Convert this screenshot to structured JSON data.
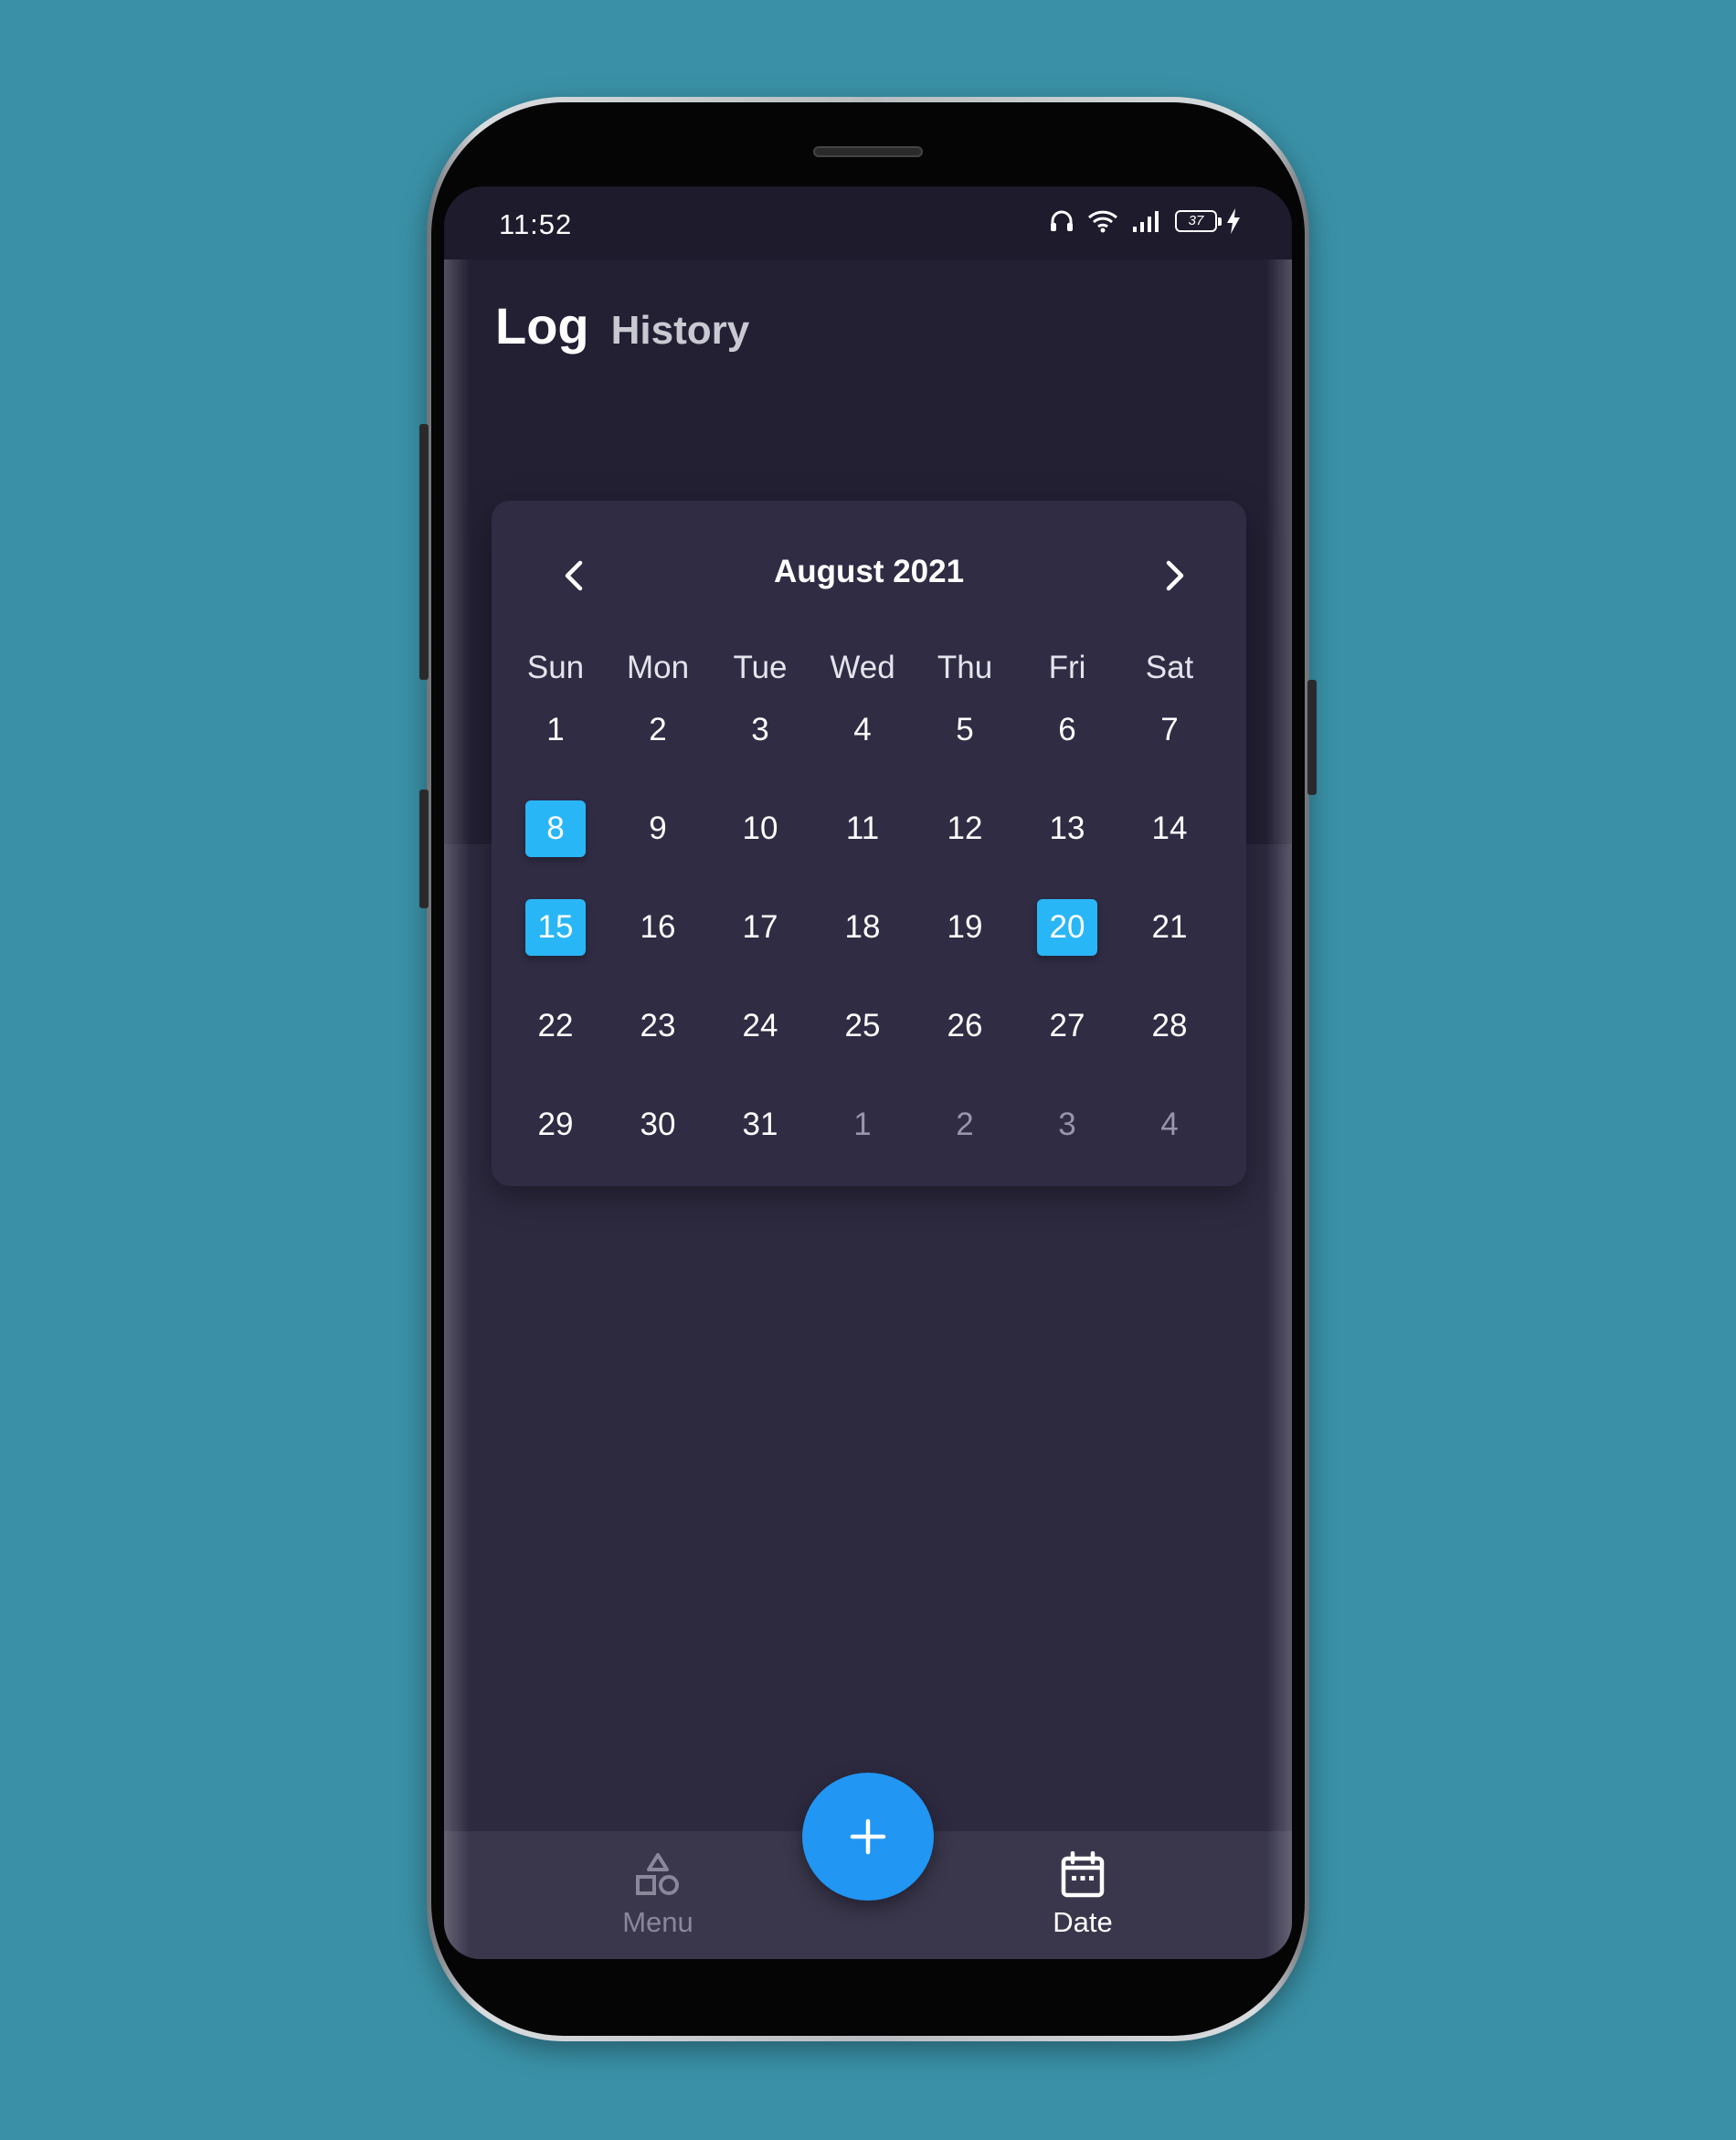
{
  "status_bar": {
    "time": "11:52",
    "battery_level": "37",
    "icons": [
      "headphones-icon",
      "wifi-icon",
      "signal-icon",
      "battery-icon",
      "charging-icon"
    ]
  },
  "header": {
    "title": "Log",
    "subtitle": "History"
  },
  "calendar": {
    "month_label": "August 2021",
    "weekdays": [
      "Sun",
      "Mon",
      "Tue",
      "Wed",
      "Thu",
      "Fri",
      "Sat"
    ],
    "weeks": [
      [
        "1",
        "2",
        "3",
        "4",
        "5",
        "6",
        "7"
      ],
      [
        "8",
        "9",
        "10",
        "11",
        "12",
        "13",
        "14"
      ],
      [
        "15",
        "16",
        "17",
        "18",
        "19",
        "20",
        "21"
      ],
      [
        "22",
        "23",
        "24",
        "25",
        "26",
        "27",
        "28"
      ],
      [
        "29",
        "30",
        "31",
        "1",
        "2",
        "3",
        "4"
      ]
    ],
    "selected_days": [
      "8",
      "15",
      "20"
    ],
    "next_month_days": [
      "1",
      "2",
      "3",
      "4"
    ],
    "accent_color": "#29b6f6"
  },
  "fab": {
    "icon": "plus-icon",
    "color": "#2196f3"
  },
  "bottom_nav": {
    "menu_label": "Menu",
    "date_label": "Date",
    "active": "Date"
  },
  "colors": {
    "background": "#3a91a7",
    "screen": "#2d2a40",
    "header": "#232034",
    "card": "#2f2c44"
  }
}
